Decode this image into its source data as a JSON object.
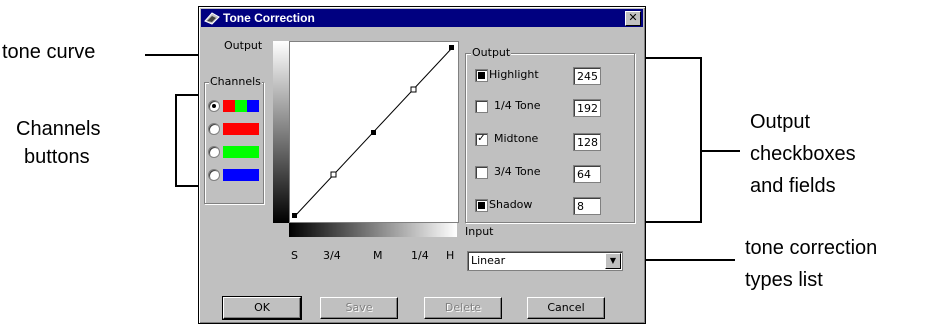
{
  "callouts": {
    "tone_curve": "tone curve",
    "channels_buttons_line1": "Channels",
    "channels_buttons_line2": "buttons",
    "output_line1": "Output",
    "output_line2": "checkboxes",
    "output_line3": "and fields",
    "types_line1": "tone correction",
    "types_line2": "types list"
  },
  "dialog": {
    "title": "Tone Correction",
    "close_glyph": "✕",
    "output_axis_label": "Output",
    "input_axis_label": "Input",
    "channels_group_label": "Channels",
    "output_group_label": "Output",
    "x_ticks": [
      "S",
      "3/4",
      "M",
      "1/4",
      "H"
    ],
    "channels": [
      {
        "selected": true,
        "colors": [
          "#ff0000",
          "#00ff00",
          "#0000ff"
        ]
      },
      {
        "selected": false,
        "colors": [
          "#ff0000"
        ]
      },
      {
        "selected": false,
        "colors": [
          "#00ff00"
        ]
      },
      {
        "selected": false,
        "colors": [
          "#0000ff"
        ]
      }
    ],
    "output_rows": [
      {
        "label": "Highlight",
        "checkbox": "filled",
        "value": "245"
      },
      {
        "label": "1/4 Tone",
        "checkbox": "unchecked",
        "value": "192"
      },
      {
        "label": "Midtone",
        "checkbox": "checked",
        "value": "128"
      },
      {
        "label": "3/4 Tone",
        "checkbox": "unchecked",
        "value": "64"
      },
      {
        "label": "Shadow",
        "checkbox": "filled",
        "value": "8"
      }
    ],
    "correction_type": "Linear",
    "combo_arrow": "▼",
    "buttons": {
      "ok": "OK",
      "save": "Save",
      "delete": "Delete",
      "cancel": "Cancel"
    },
    "check_glyph": "✓"
  }
}
